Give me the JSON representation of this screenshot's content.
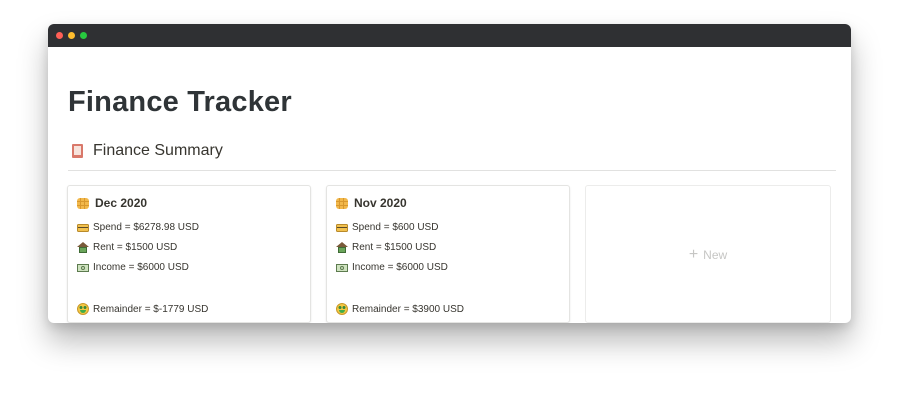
{
  "page": {
    "title": "Finance Tracker"
  },
  "section": {
    "icon": "book-icon",
    "title": "Finance Summary"
  },
  "cards": [
    {
      "title": "Dec 2020",
      "title_icon": "waffle-icon",
      "spend": "Spend = $6278.98 USD",
      "rent": "Rent = $1500 USD",
      "income": "Income = $6000 USD",
      "remainder": "Remainder = $-1779 USD"
    },
    {
      "title": "Nov 2020",
      "title_icon": "waffle-icon",
      "spend": "Spend = $600 USD",
      "rent": "Rent = $1500 USD",
      "income": "Income = $6000 USD",
      "remainder": "Remainder = $3900 USD"
    }
  ],
  "new_card": {
    "label": "New",
    "icon": "plus-icon"
  },
  "colors": {
    "titlebar": "#2f3033",
    "close": "#ff5f56",
    "minimize": "#ffbd2e",
    "maximize": "#27c93f",
    "text": "#37352f",
    "muted": "#c6c6c4"
  }
}
